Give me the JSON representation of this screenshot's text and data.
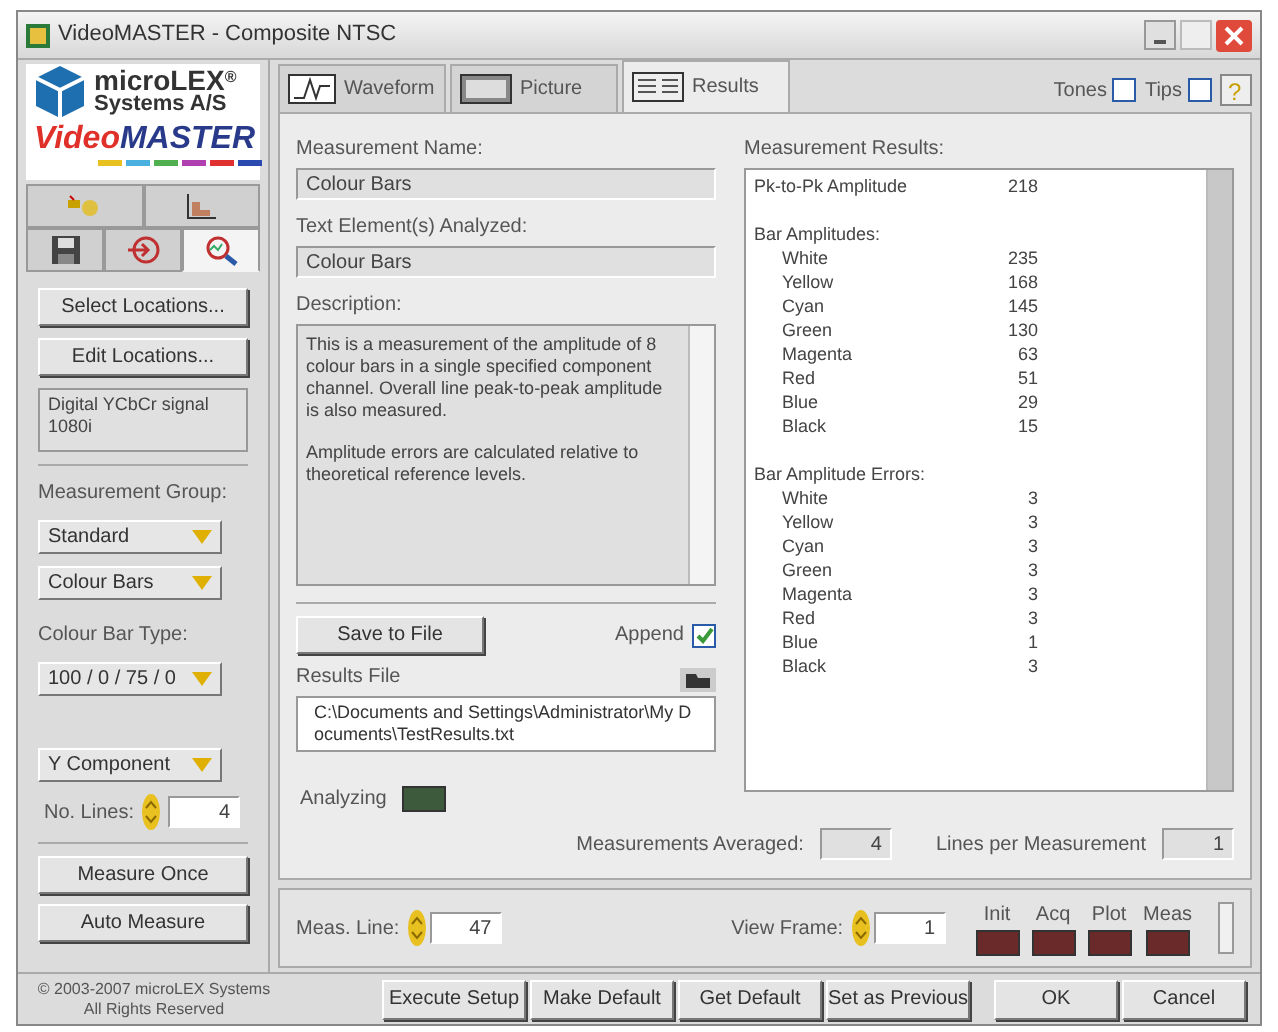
{
  "window": {
    "title": "VideoMASTER - Composite NTSC"
  },
  "logo": {
    "company": "microLEX",
    "registered": "®",
    "company_line2": "Systems A/S",
    "product_a": "Video",
    "product_b": "MASTER"
  },
  "icon_tabs": [
    [
      {
        "kind": "wand",
        "selected": false
      },
      {
        "kind": "chart",
        "selected": false
      }
    ],
    [
      {
        "kind": "save",
        "selected": false
      },
      {
        "kind": "enter",
        "selected": false
      },
      {
        "kind": "zoom",
        "selected": true
      }
    ]
  ],
  "sidebar": {
    "buttons": [
      "Select Locations...",
      "Edit Locations..."
    ],
    "signal": "Digital YCbCr signal 1080i",
    "group_label": "Measurement Group:",
    "group_dropdowns": [
      "Standard",
      "Colour Bars"
    ],
    "bar_type_label": "Colour Bar Type:",
    "bar_type": "100 / 0 / 75 / 0",
    "component": "Y Component",
    "lines_label": "No. Lines:",
    "lines_value": "4",
    "actions": [
      "Measure Once",
      "Auto Measure"
    ],
    "copyright": "© 2003-2007 microLEX Systems",
    "rights": "All Rights Reserved"
  },
  "tabs": [
    {
      "label": "Waveform",
      "kind": "waveform",
      "selected": false
    },
    {
      "label": "Picture",
      "kind": "picture",
      "selected": false
    },
    {
      "label": "Results",
      "kind": "results",
      "selected": true
    }
  ],
  "help": "?",
  "toggles": [
    {
      "label": "Tones",
      "checked": false
    },
    {
      "label": "Tips",
      "checked": false
    }
  ],
  "measurement_name": {
    "label": "Measurement Name:",
    "value": "Colour Bars"
  },
  "text_element": {
    "label": "Text Element(s) Analyzed:",
    "value": "Colour Bars"
  },
  "description": {
    "label": "Description:",
    "paragraphs": [
      "This is a measurement of the amplitude of 8 colour bars in a single specified component channel.  Overall line peak-to-peak amplitude is also measured.",
      "Amplitude errors are calculated relative to theoretical reference levels."
    ]
  },
  "save_button": "Save to File",
  "append": {
    "label": "Append",
    "checked": true
  },
  "results_file": {
    "label": "Results File",
    "path": "C:\\Documents and Settings\\Administrator\\My Documents\\TestResults.txt"
  },
  "analyzing": {
    "label": "Analyzing",
    "on": false
  },
  "results": {
    "label": "Measurement Results:",
    "items": [
      {
        "label": "Pk-to-Pk Amplitude",
        "value": "218"
      },
      {
        "label": "Bar Amplitudes:",
        "children": [
          {
            "label": "White",
            "value": "235"
          },
          {
            "label": "Yellow",
            "value": "168"
          },
          {
            "label": "Cyan",
            "value": "145"
          },
          {
            "label": "Green",
            "value": "130"
          },
          {
            "label": "Magenta",
            "value": "63"
          },
          {
            "label": "Red",
            "value": "51"
          },
          {
            "label": "Blue",
            "value": "29"
          },
          {
            "label": "Black",
            "value": "15"
          }
        ]
      },
      {
        "label": "Bar Amplitude Errors:",
        "children": [
          {
            "label": "White",
            "value": "3"
          },
          {
            "label": "Yellow",
            "value": "3"
          },
          {
            "label": "Cyan",
            "value": "3"
          },
          {
            "label": "Green",
            "value": "3"
          },
          {
            "label": "Magenta",
            "value": "3"
          },
          {
            "label": "Red",
            "value": "3"
          },
          {
            "label": "Blue",
            "value": "1"
          },
          {
            "label": "Black",
            "value": "3"
          }
        ]
      }
    ]
  },
  "averaged": {
    "label": "Measurements Averaged:",
    "value": "4"
  },
  "lines_per": {
    "label": "Lines per Measurement",
    "value": "1"
  },
  "meas_line": {
    "label": "Meas. Line:",
    "value": "47"
  },
  "view_frame": {
    "label": "View Frame:",
    "value": "1"
  },
  "indicators": [
    {
      "label": "Init",
      "on": false
    },
    {
      "label": "Acq",
      "on": false
    },
    {
      "label": "Plot",
      "on": false
    },
    {
      "label": "Meas",
      "on": false
    }
  ],
  "footer_buttons": [
    "Execute Setup",
    "Make Default",
    "Get Default",
    "Set as Previous"
  ],
  "dialog_buttons": [
    "OK",
    "Cancel"
  ]
}
